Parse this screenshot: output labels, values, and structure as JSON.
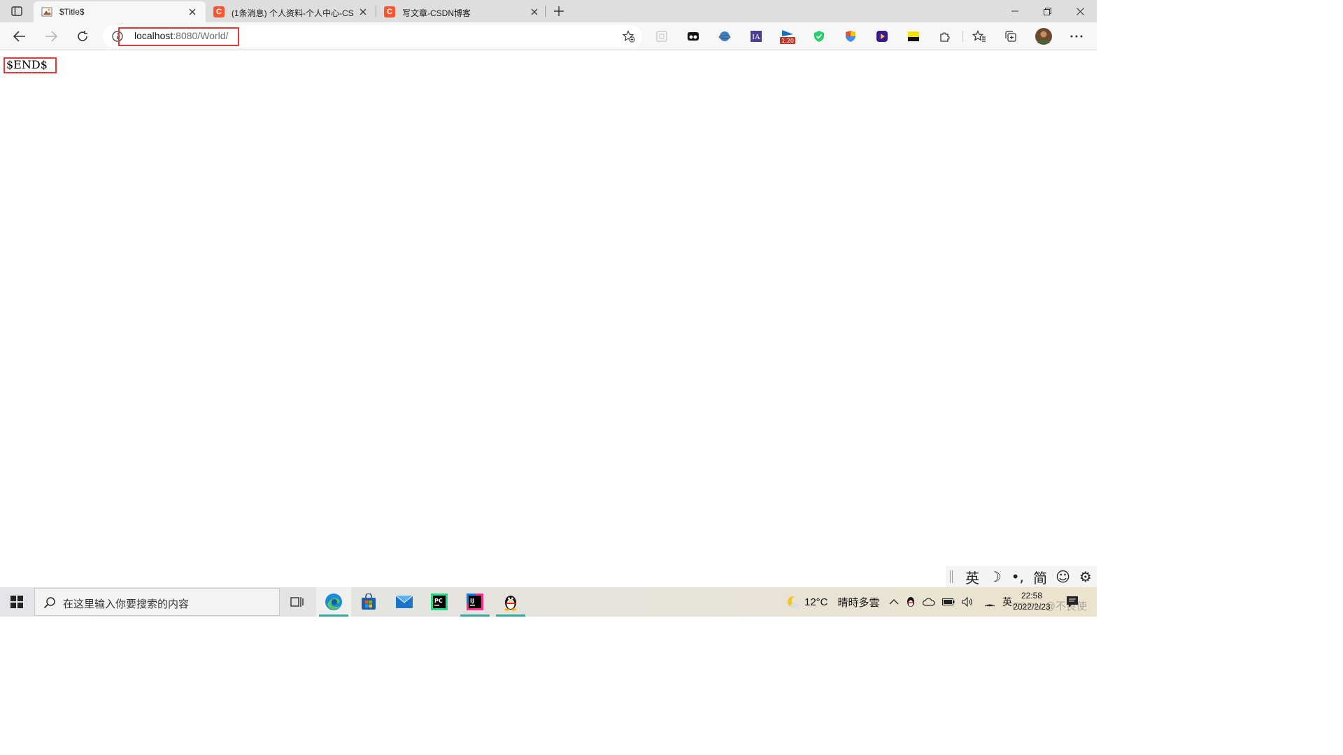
{
  "tabs": [
    {
      "title": "$Title$",
      "active": true
    },
    {
      "title": "(1条消息) 个人资料-个人中心-CS",
      "active": false
    },
    {
      "title": "写文章-CSDN博客",
      "active": false
    }
  ],
  "toolbar": {
    "url_host": "localhost",
    "url_rest": ":8080/World/",
    "extension_badge": "1.20"
  },
  "page": {
    "body_text": "$END$"
  },
  "ime": {
    "items": [
      "英",
      "☽",
      "•,",
      "简",
      "☺",
      "⚙"
    ]
  },
  "taskbar": {
    "search_placeholder": "在这里输入你要搜索的内容",
    "weather_temp": "12°C",
    "weather_desc": "晴時多雲",
    "lang": "英",
    "time": "22:58",
    "date": "2022/2/23",
    "watermark": "CSDN @不良使"
  },
  "colors": {
    "highlight_box": "#e53935",
    "csdn": "#fc5531",
    "tabstrip": "#dedede",
    "toolbar": "#f7f7f7"
  }
}
